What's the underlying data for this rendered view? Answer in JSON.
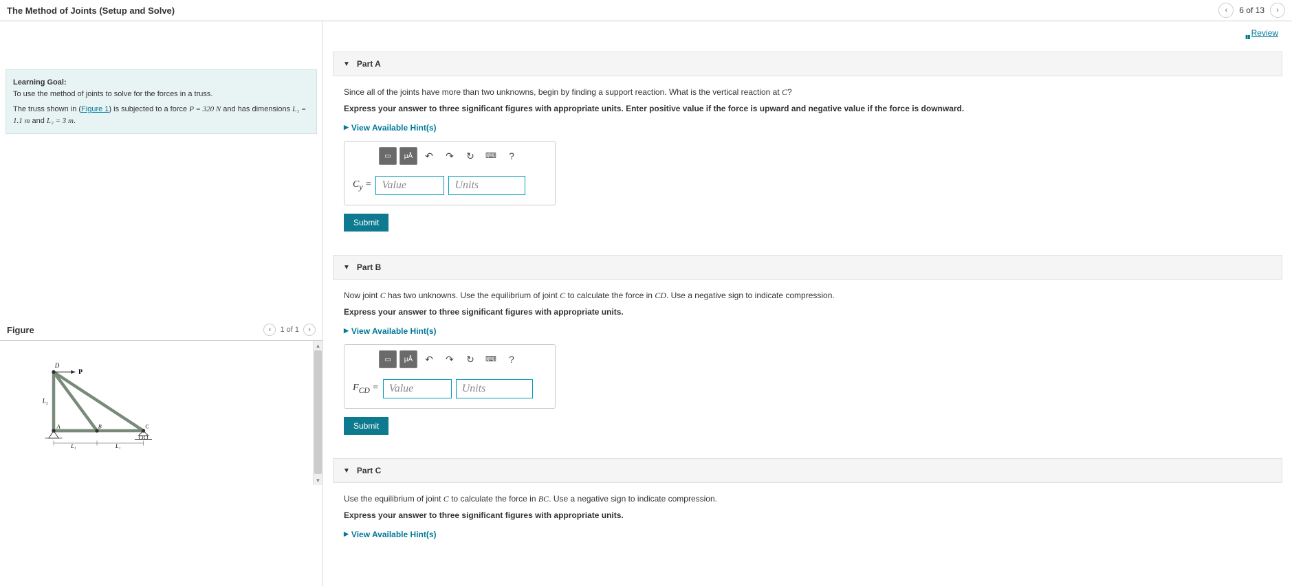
{
  "header": {
    "title": "The Method of Joints (Setup and Solve)",
    "nav_count": "6 of 13"
  },
  "review_link": "Review",
  "goal": {
    "label": "Learning Goal:",
    "text": "To use the method of joints to solve for the forces in a truss.",
    "problem_pre": "The truss shown in (",
    "figure_link": "Figure 1",
    "problem_mid": ") is subjected to a force ",
    "force_expr": "P = 320 N",
    "problem_mid2": " and has dimensions ",
    "L1_expr": "L₁ = 1.1 m",
    "and": " and ",
    "L2_expr": "L₂ = 3 m",
    "period": "."
  },
  "figure": {
    "title": "Figure",
    "nav": "1 of 1",
    "labels": {
      "D": "D",
      "P": "P",
      "L2": "L₂",
      "A": "A",
      "B": "B",
      "C": "C",
      "L1a": "L₁",
      "L1b": "L₁"
    }
  },
  "parts": {
    "A": {
      "title": "Part A",
      "instr_pre": "Since all of the joints have more than two unknowns, begin by finding a support reaction. What is the vertical reaction at ",
      "instr_var": "C",
      "instr_post": "?",
      "format": "Express your answer to three significant figures with appropriate units. Enter positive value if the force is upward and negative value if the force is downward.",
      "hints": "View Available Hint(s)",
      "var_label": "Cᵧ =",
      "value_ph": "Value",
      "units_ph": "Units",
      "submit": "Submit"
    },
    "B": {
      "title": "Part B",
      "instr_pre": "Now joint ",
      "instr_var1": "C",
      "instr_mid": " has two unknowns. Use the equilibrium of joint ",
      "instr_var2": "C",
      "instr_mid2": " to calculate the force in ",
      "instr_var3": "CD",
      "instr_post": ". Use a negative sign to indicate compression.",
      "format": "Express your answer to three significant figures with appropriate units.",
      "hints": "View Available Hint(s)",
      "var_label": "F_CD =",
      "value_ph": "Value",
      "units_ph": "Units",
      "submit": "Submit"
    },
    "C": {
      "title": "Part C",
      "instr_pre": "Use the equilibrium of joint ",
      "instr_var1": "C",
      "instr_mid": " to calculate the force in ",
      "instr_var2": "BC",
      "instr_post": ". Use a negative sign to indicate compression.",
      "format": "Express your answer to three significant figures with appropriate units.",
      "hints": "View Available Hint(s)"
    }
  },
  "toolbar": {
    "template": "▭",
    "units_btn": "μÅ",
    "undo": "↶",
    "redo": "↷",
    "reset": "↻",
    "keyboard": "⌨",
    "help": "?"
  }
}
